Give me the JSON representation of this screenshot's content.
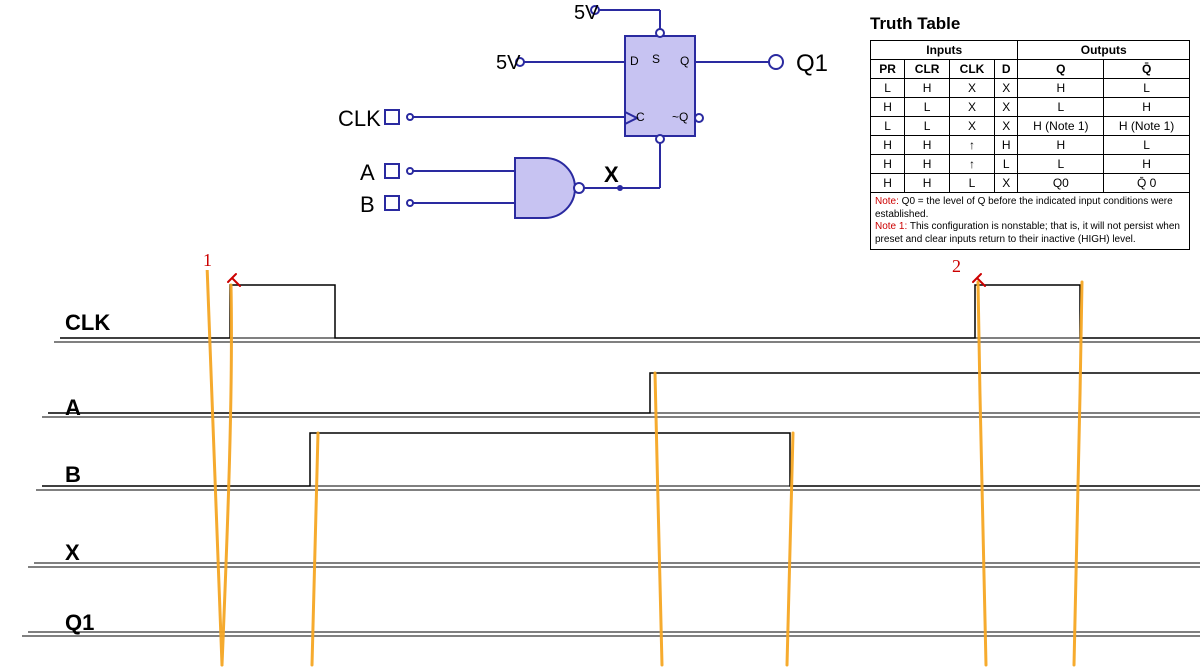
{
  "circuit": {
    "vcc1": "5V",
    "vcc2": "5V",
    "clk": "CLK",
    "a": "A",
    "b": "B",
    "x": "X",
    "q1": "Q1",
    "pin_d": "D",
    "pin_s": "S",
    "pin_q": "Q",
    "pin_c": "C",
    "pin_nq": "~Q"
  },
  "truth": {
    "title": "Truth Table",
    "head_inputs": "Inputs",
    "head_outputs": "Outputs",
    "cols": [
      "PR",
      "CLR",
      "CLK",
      "D",
      "Q",
      "Q̄"
    ],
    "rows": [
      [
        "L",
        "H",
        "X",
        "X",
        "H",
        "L"
      ],
      [
        "H",
        "L",
        "X",
        "X",
        "L",
        "H"
      ],
      [
        "L",
        "L",
        "X",
        "X",
        "H (Note 1)",
        "H (Note 1)"
      ],
      [
        "H",
        "H",
        "↑",
        "H",
        "H",
        "L"
      ],
      [
        "H",
        "H",
        "↑",
        "L",
        "L",
        "H"
      ],
      [
        "H",
        "H",
        "L",
        "X",
        "Q0",
        "Q̄ 0"
      ]
    ],
    "note0_a": "Note:",
    "note0_b": " Q0 = the level of Q before the indicated input conditions were established.",
    "note1_a": "Note 1:",
    "note1_b": " This configuration is nonstable; that is, it will not persist when preset and clear inputs return to their inactive (HIGH) level."
  },
  "timing": {
    "labels": [
      "CLK",
      "A",
      "B",
      "X",
      "Q1"
    ]
  },
  "annot": {
    "one": "1",
    "two": "2"
  }
}
